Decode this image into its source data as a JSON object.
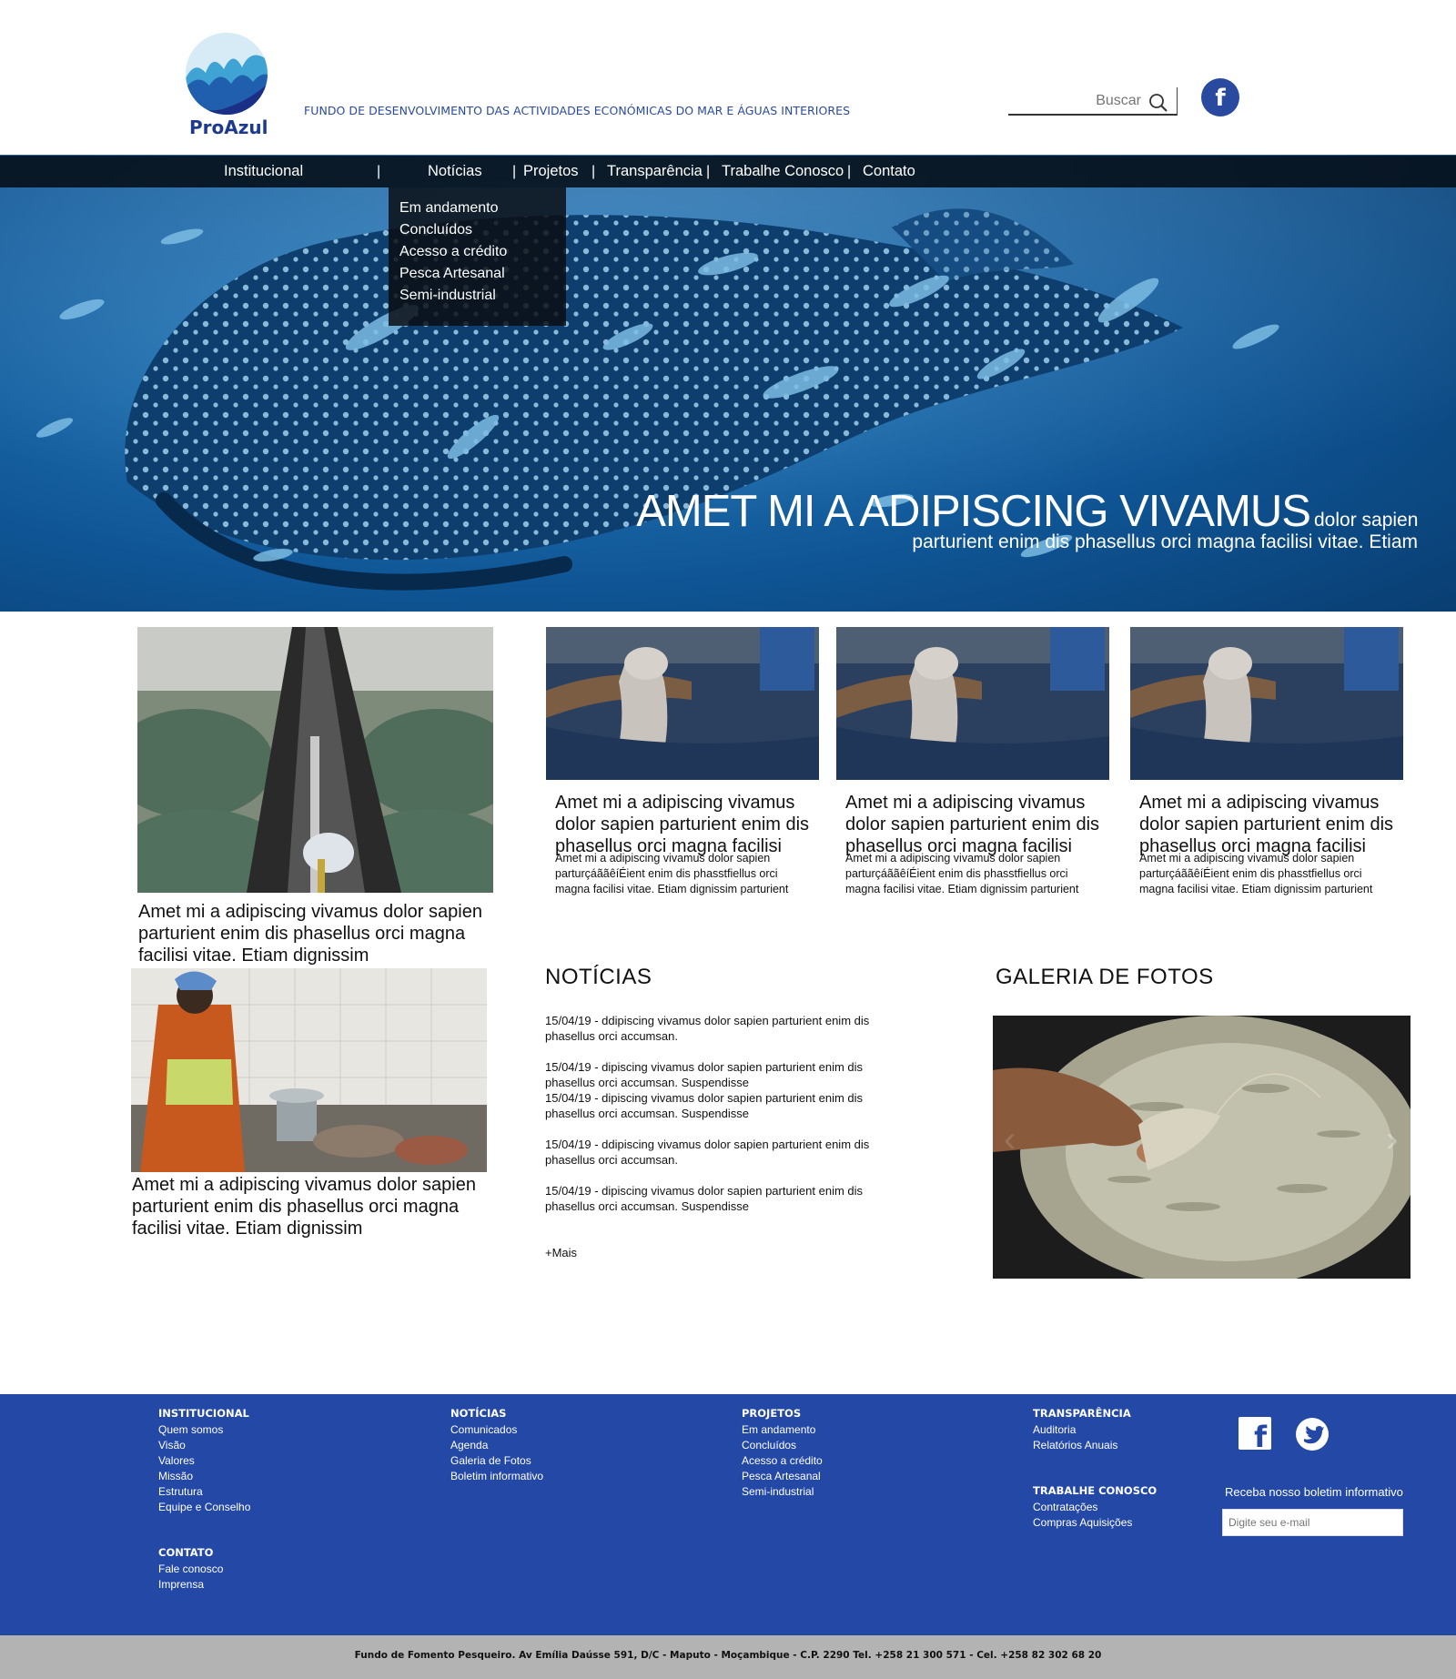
{
  "brand": {
    "logo_text": "ProAzul",
    "tagline": "FUNDO DE DESENVOLVIMENTO DAS ACTIVIDADES ECONÓMICAS DO MAR E ÁGUAS INTERIORES",
    "accent_color": "#2348a6"
  },
  "search": {
    "placeholder": "Buscar"
  },
  "social_header": {
    "facebook_glyph": "f"
  },
  "nav": {
    "items": [
      "Institucional",
      "Notícias",
      "Projetos",
      "Transparência",
      "Trabalhe Conosco",
      "Contato"
    ],
    "separator": "|",
    "dropdown": [
      "Em andamento",
      "Concluídos",
      "Acesso a crédito",
      "Pesca Artesanal",
      "Semi-industrial"
    ]
  },
  "hero": {
    "title_big": "AMET MI A ADIPISCING VIVAMUS",
    "title_small": "dolor sapien",
    "subtitle": "parturient enim dis phasellus orci magna facilisi vitae. Etiam"
  },
  "features": [
    {
      "title": "Amet mi a adipiscing vivamus dolor sapien parturient enim dis phasellus orci magna facilisi vitae. Etiam dignissim"
    },
    {
      "title": "Amet mi a adipiscing vivamus dolor sapien parturient enim dis phasellus orci magna facilisi vitae. Etiam dignissim"
    }
  ],
  "cards": [
    {
      "title": "Amet mi a adipiscing vivamus dolor sapien parturient enim dis phasellus orci magna facilisi",
      "desc": "Amet mi a adipiscing vivamus dolor sapien parturçáããêíÉient enim dis phasstfiellus orci magna facilisi vitae. Etiam dignissim parturient"
    },
    {
      "title": "Amet mi a adipiscing vivamus dolor sapien parturient enim dis phasellus orci magna facilisi",
      "desc": "Amet mi a adipiscing vivamus dolor sapien parturçáããêíÉient enim dis phasstfiellus orci magna facilisi vitae. Etiam dignissim parturient"
    },
    {
      "title": "Amet mi a adipiscing vivamus dolor sapien parturient enim dis phasellus orci magna facilisi",
      "desc": "Amet mi a adipiscing vivamus dolor sapien parturçáããêíÉient enim dis phasstfiellus orci magna facilisi vitae. Etiam dignissim parturient"
    }
  ],
  "news": {
    "heading": "NOTÍCIAS",
    "items": [
      "15/04/19 - ddipiscing vivamus dolor sapien parturient enim dis phasellus orci accumsan.",
      "15/04/19 - dipiscing vivamus dolor sapien parturient enim dis phasellus orci accumsan. Suspendisse",
      "15/04/19 - dipiscing vivamus dolor sapien parturient enim dis phasellus orci accumsan. Suspendisse",
      "15/04/19 - ddipiscing vivamus dolor sapien parturient enim dis phasellus orci accumsan.",
      "15/04/19 - dipiscing vivamus dolor sapien parturient enim dis phasellus orci accumsan. Suspendisse"
    ],
    "more": "+Mais"
  },
  "gallery": {
    "heading": "GALERIA DE FOTOS",
    "prev": "‹",
    "next": "›"
  },
  "footer": {
    "institucional": {
      "heading": "INSTITUCIONAL",
      "links": [
        "Quem somos",
        "Visão",
        "Valores",
        "Missão",
        "Estrutura",
        "Equipe e Conselho"
      ]
    },
    "contato": {
      "heading": "CONTATO",
      "links": [
        "Fale conosco",
        "Imprensa"
      ]
    },
    "noticias": {
      "heading": "NOTÍCIAS",
      "links": [
        "Comunicados",
        "Agenda",
        "Galeria de Fotos",
        "Boletim informativo"
      ]
    },
    "projetos": {
      "heading": "PROJETOS",
      "links": [
        "Em andamento",
        "Concluídos",
        "Acesso a crédito",
        "Pesca Artesanal",
        "Semi-industrial"
      ]
    },
    "transparencia": {
      "heading": "TRANSPARÊNCIA",
      "links": [
        "Auditoria",
        "Relatórios Anuais"
      ]
    },
    "trabalhe": {
      "heading": "TRABALHE CONOSCO",
      "links": [
        "Contratações",
        "Compras Aquisições"
      ]
    },
    "newsletter_label": "Receba nosso boletim informativo",
    "newsletter_placeholder": "Digite seu e-mail",
    "facebook_glyph": "f",
    "address": "Fundo de Fomento Pesqueiro. Av Emília Daússe 591, D/C - Maputo - Moçambique - C.P. 2290 Tel. +258 21 300 571 - Cel. +258 82 302 68 20"
  }
}
